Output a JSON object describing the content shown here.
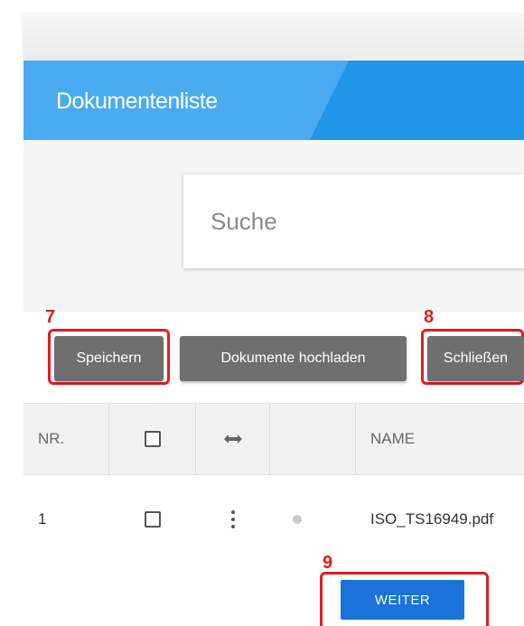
{
  "header": {
    "title": "Dokumentenliste"
  },
  "search": {
    "placeholder": "Suche"
  },
  "markers": {
    "m7": "7",
    "m8": "8",
    "m9": "9"
  },
  "toolbar": {
    "save_label": "Speichern",
    "upload_label": "Dokumente hochladen",
    "close_label": "Schließen"
  },
  "table": {
    "columns": {
      "nr": "NR.",
      "name": "NAME"
    },
    "rows": [
      {
        "nr": "1",
        "name": "ISO_TS16949.pdf"
      }
    ]
  },
  "weiter_label": "WEITER",
  "colors": {
    "header_blue": "#2196e8",
    "header_band": "#4aabf1",
    "button_gray": "#6f6f6f",
    "primary_blue": "#1a73d9",
    "highlight_red": "#e31b23"
  },
  "icons": [
    "checkbox-icon",
    "resize-arrows-icon",
    "kebab-menu-icon",
    "status-dot-icon"
  ]
}
